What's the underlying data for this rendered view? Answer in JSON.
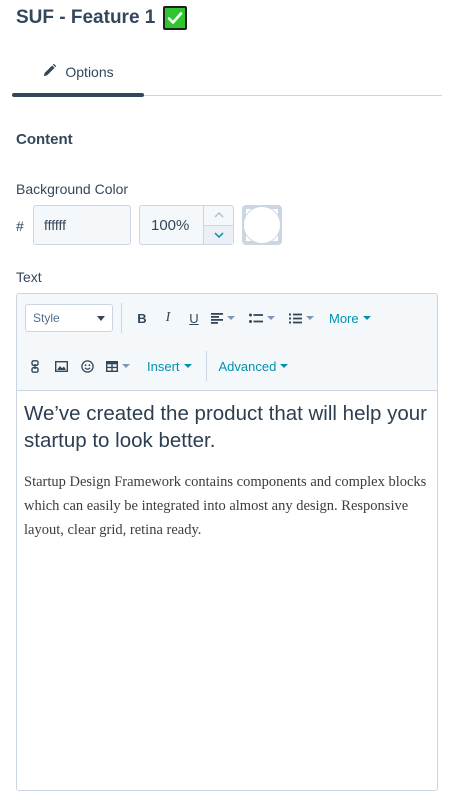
{
  "header": {
    "title": "SUF - Feature 1"
  },
  "tabs": [
    {
      "label": "Options",
      "icon": "pencil-icon",
      "active": true
    }
  ],
  "content_section": {
    "title": "Content"
  },
  "background_color": {
    "label": "Background Color",
    "hash": "#",
    "hex_value": "ffffff",
    "opacity": "100%",
    "swatch_color": "#ffffff"
  },
  "text_field": {
    "label": "Text",
    "toolbar": {
      "style_select": "Style",
      "more": "More",
      "insert": "Insert",
      "advanced": "Advanced"
    },
    "headline": "We’ve created the product that will help your startup to look better.",
    "body": "Startup Design Framework contains components and complex blocks which can easily be integrated into almost any design. Responsive layout, clear grid, retina ready."
  },
  "colors": {
    "accent": "#0091ae",
    "text": "#33475b",
    "border": "#cbd6e2",
    "check": "#2ec52e"
  }
}
